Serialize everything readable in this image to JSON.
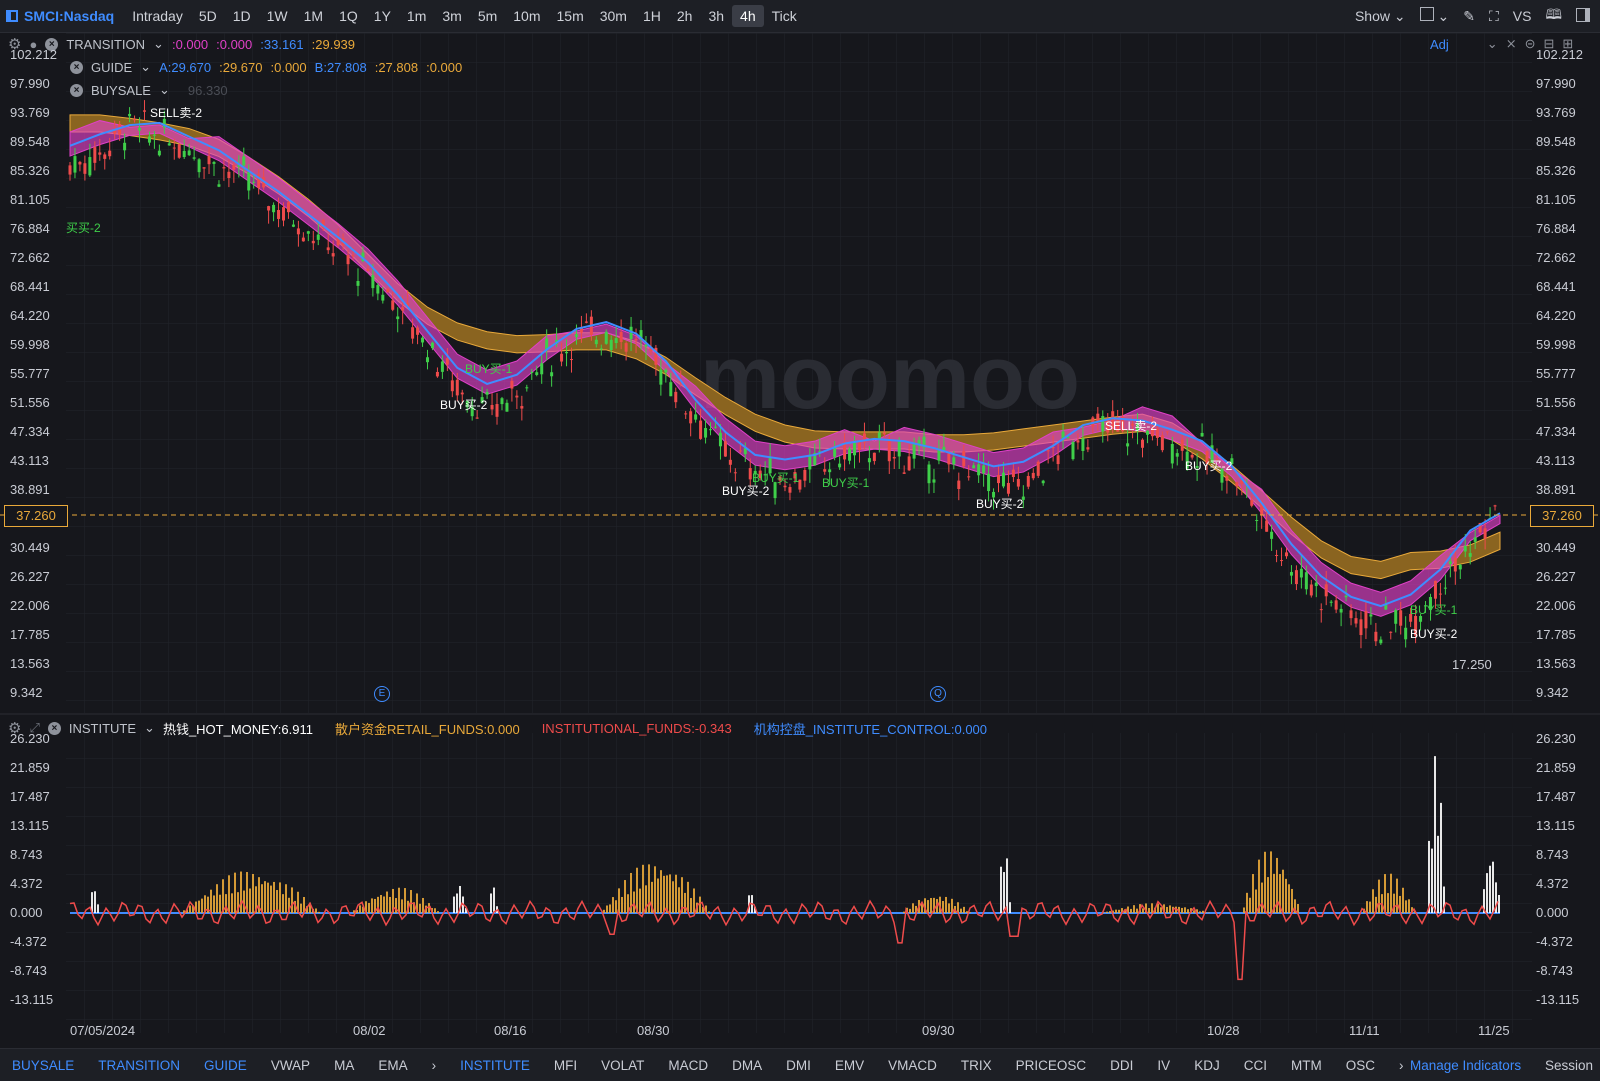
{
  "toolbar": {
    "symbol": "SMCI:Nasdaq",
    "timeframes": [
      "Intraday",
      "5D",
      "1D",
      "1W",
      "1M",
      "1Q",
      "1Y",
      "1m",
      "3m",
      "5m",
      "10m",
      "15m",
      "30m",
      "1H",
      "2h",
      "3h",
      "4h",
      "Tick"
    ],
    "active_timeframe": "4h",
    "show_label": "Show",
    "vs_label": "VS"
  },
  "indicators": {
    "transition": {
      "name": "TRANSITION",
      "v1": ":0.000",
      "v2": ":0.000",
      "v3": ":33.161",
      "v4": ":29.939"
    },
    "guide": {
      "name": "GUIDE",
      "a": "A:29.670",
      "a2": ":29.670",
      "z1": ":0.000",
      "b": "B:27.808",
      "b2": ":27.808",
      "z2": ":0.000"
    },
    "buysale": {
      "name": "BUYSALE",
      "hint": "96.330"
    },
    "adj_label": "Adj",
    "institute": {
      "name": "INSTITUTE",
      "hot": "热钱_HOT_MONEY:6.911",
      "retail": "散户资金RETAIL_FUNDS:0.000",
      "inst": "INSTITUTIONAL_FUNDS:-0.343",
      "control": "机构控盘_INSTITUTE_CONTROL:0.000"
    }
  },
  "chart_data": [
    {
      "type": "line",
      "title": "",
      "price_ticks": [
        "102.212",
        "97.990",
        "93.769",
        "89.548",
        "85.326",
        "81.105",
        "76.884",
        "72.662",
        "68.441",
        "64.220",
        "59.998",
        "55.777",
        "51.556",
        "47.334",
        "43.113",
        "38.891",
        "34.670",
        "30.449",
        "26.227",
        "22.006",
        "17.785",
        "13.563",
        "9.342"
      ],
      "current_price": "37.260",
      "low_label": "17.250",
      "x_labels": [
        "07/05/2024",
        "08/02",
        "08/16",
        "08/30",
        "09/30",
        "10/28",
        "11/11",
        "11/25"
      ],
      "series": [
        {
          "name": "price",
          "values": [
            86,
            88,
            92,
            90,
            89,
            86,
            84,
            80,
            77,
            74,
            70,
            66,
            60,
            54,
            50,
            53,
            58,
            61,
            62,
            61,
            56,
            50,
            44,
            42,
            40,
            42,
            44,
            45,
            44,
            43,
            42,
            40,
            39,
            44,
            47,
            48,
            47,
            46,
            44,
            42,
            35,
            28,
            24,
            21,
            19,
            20,
            26,
            30,
            37
          ]
        }
      ]
    },
    {
      "type": "area",
      "title": "",
      "ticks": [
        "26.230",
        "21.859",
        "17.487",
        "13.115",
        "8.743",
        "4.372",
        "0.000",
        "-4.372",
        "-8.743",
        "-13.115"
      ]
    }
  ],
  "signals": [
    {
      "text": "SELL卖-2",
      "kind": "sell"
    },
    {
      "text": "BUY买-2",
      "kind": "buy2"
    },
    {
      "text": "BUY买-1",
      "kind": "buy1"
    },
    {
      "text": "BUY买-2",
      "kind": "buy2"
    },
    {
      "text": "BUY买-1",
      "kind": "buy1"
    },
    {
      "text": "BUY买-1",
      "kind": "buy1"
    },
    {
      "text": "BUY买-2",
      "kind": "buy2"
    },
    {
      "text": "SELL卖-2",
      "kind": "sell"
    },
    {
      "text": "BUY买-2",
      "kind": "buy2"
    },
    {
      "text": "BUY买-1",
      "kind": "buy1"
    },
    {
      "text": "BUY买-2",
      "kind": "buy2"
    },
    {
      "text": "买买-2",
      "kind": "buy1"
    }
  ],
  "watermark": "moomoo",
  "bottom_tabs": [
    "BUYSALE",
    "TRANSITION",
    "GUIDE",
    "VWAP",
    "MA",
    "EMA",
    "INSTITUTE",
    "MFI",
    "VOLAT",
    "MACD",
    "DMA",
    "DMI",
    "EMV",
    "VMACD",
    "TRIX",
    "PRICEOSC",
    "DDI",
    "IV",
    "KDJ",
    "CCI",
    "MTM",
    "OSC"
  ],
  "manage_label": "Manage Indicators",
  "session_label": "Session",
  "event_icons": [
    "E",
    "Q"
  ],
  "colors": {
    "bg": "#16171c",
    "accent": "#3f8cff",
    "yellow": "#e9a93a",
    "magenta": "#e040c8",
    "green": "#3fcf4a",
    "red": "#ef4b4b"
  }
}
